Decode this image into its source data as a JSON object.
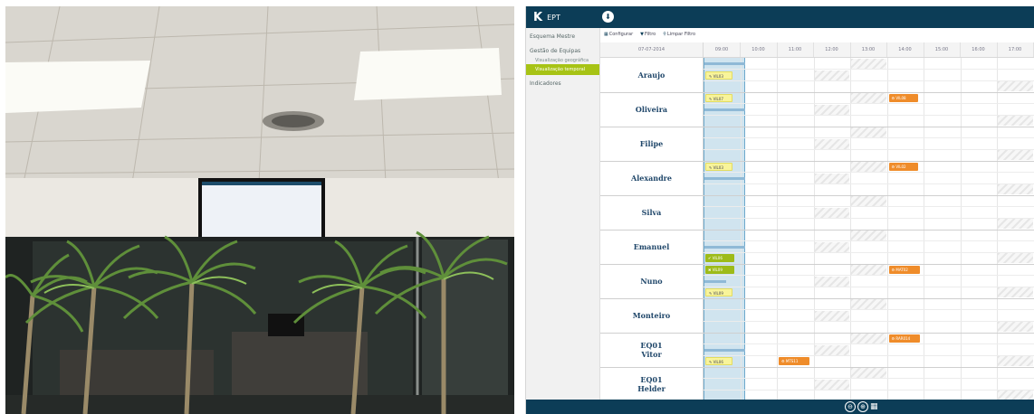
{
  "app": {
    "logo_text": "EPT",
    "logo_mark": "K"
  },
  "sidebar": {
    "items": [
      {
        "label": "Esquema Mestre",
        "level": "top"
      },
      {
        "label": "Gestão de Equipas",
        "level": "top"
      },
      {
        "label": "Visualização geográfica",
        "level": "sub"
      },
      {
        "label": "Visualização temporal",
        "level": "active"
      },
      {
        "label": "Indicadores",
        "level": "top"
      }
    ]
  },
  "toolbar": {
    "configure": "Configurar",
    "filter": "Filtro",
    "clear_filter": "Limpar Filtro"
  },
  "schedule": {
    "date": "07-07-2014",
    "hours": [
      "09:00",
      "10:00",
      "11:00",
      "12:00",
      "13:00",
      "14:00",
      "15:00",
      "16:00",
      "17:00"
    ],
    "rows": [
      {
        "name": "Araujo"
      },
      {
        "name": "Oliveira"
      },
      {
        "name": "Filipe"
      },
      {
        "name": "Alexandre"
      },
      {
        "name": "Silva"
      },
      {
        "name": "Emanuel"
      },
      {
        "name": "Nuno"
      },
      {
        "name": "Monteiro"
      },
      {
        "name": "EQ01\nVitor"
      },
      {
        "name": "EQ01\nHelder"
      }
    ],
    "tasks": [
      {
        "row": 0,
        "sub": 1,
        "hour": 0.0,
        "len": 0.75,
        "color": "yellow",
        "icon": "✎",
        "code": "VIL03"
      },
      {
        "row": 1,
        "sub": 0,
        "hour": 0.0,
        "len": 0.75,
        "color": "yellow",
        "icon": "✎",
        "code": "VIL07"
      },
      {
        "row": 1,
        "sub": 0,
        "hour": 5.0,
        "len": 0.8,
        "color": "orange",
        "icon": "⚙",
        "code": "VIL08"
      },
      {
        "row": 3,
        "sub": 0,
        "hour": 0.0,
        "len": 0.75,
        "color": "yellow",
        "icon": "✎",
        "code": "VIL03"
      },
      {
        "row": 3,
        "sub": 0,
        "hour": 5.0,
        "len": 0.8,
        "color": "orange",
        "icon": "⚙",
        "code": "VIL02"
      },
      {
        "row": 5,
        "sub": 2,
        "hour": 0.0,
        "len": 0.8,
        "color": "green",
        "icon": "✔",
        "code": "VIL06"
      },
      {
        "row": 6,
        "sub": 0,
        "hour": 0.0,
        "len": 0.8,
        "color": "green",
        "icon": "✖",
        "code": "VIL09"
      },
      {
        "row": 6,
        "sub": 0,
        "hour": 5.0,
        "len": 0.85,
        "color": "orange",
        "icon": "⚙",
        "code": "MAT02"
      },
      {
        "row": 6,
        "sub": 2,
        "hour": 0.0,
        "len": 0.75,
        "color": "yellow",
        "icon": "✎",
        "code": "VIL09"
      },
      {
        "row": 8,
        "sub": 0,
        "hour": 5.0,
        "len": 0.85,
        "color": "orange",
        "icon": "⚙",
        "code": "RAR014"
      },
      {
        "row": 8,
        "sub": 2,
        "hour": 0.0,
        "len": 0.75,
        "color": "yellow",
        "icon": "✎",
        "code": "VIL06"
      },
      {
        "row": 8,
        "sub": 2,
        "hour": 2.0,
        "len": 0.85,
        "color": "orange",
        "icon": "⚙",
        "code": "MTS11"
      }
    ],
    "bars": [
      {
        "row": 0,
        "sub": 0,
        "hour": 0.0,
        "len": 1.1
      },
      {
        "row": 1,
        "sub": 1,
        "hour": 0.0,
        "len": 1.1
      },
      {
        "row": 3,
        "sub": 1,
        "hour": 0.0,
        "len": 1.1
      },
      {
        "row": 5,
        "sub": 1,
        "hour": 0.0,
        "len": 1.1
      },
      {
        "row": 6,
        "sub": 1,
        "hour": 0.0,
        "len": 0.6
      },
      {
        "row": 8,
        "sub": 1,
        "hour": 0.0,
        "len": 1.1
      }
    ]
  },
  "footer": {
    "buttons": [
      "⊖",
      "⊕",
      "▦"
    ]
  },
  "colors": {
    "brand_dark": "#0c3d57",
    "active_green": "#a7c315",
    "task_orange": "#ef8c2a",
    "task_yellow": "#f8f49a"
  }
}
